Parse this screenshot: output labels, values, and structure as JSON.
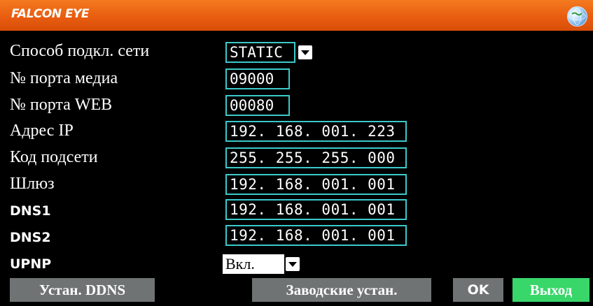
{
  "header": {
    "brand": "FALCON EYE",
    "globe_icon": "globe-icon",
    "colors": {
      "title_bar": "#e85d10",
      "field_border": "#3cc9c9",
      "button_gray": "#6f7374",
      "button_green": "#39d66a"
    }
  },
  "fields": {
    "connection_method": {
      "label": "Способ подкл. сети",
      "value": "STATIC"
    },
    "media_port": {
      "label": "№ порта медиа",
      "value": "09000"
    },
    "web_port": {
      "label": "№ порта WEB",
      "value": "00080"
    },
    "ip_address": {
      "label": "Адрес IP",
      "value": "192. 168. 001. 223"
    },
    "subnet_mask": {
      "label": "Код подсети",
      "value": "255. 255. 255. 000"
    },
    "gateway": {
      "label": "Шлюз",
      "value": "192. 168. 001. 001"
    },
    "dns1": {
      "label": "DNS1",
      "value": "192. 168. 001. 001"
    },
    "dns2": {
      "label": "DNS2",
      "value": "192. 168. 001. 001"
    },
    "upnp": {
      "label": "UPNP",
      "value": "Вкл."
    }
  },
  "buttons": {
    "ddns": "Устан. DDNS",
    "factory_defaults": "Заводские устан.",
    "ok": "OK",
    "exit": "Выход"
  }
}
